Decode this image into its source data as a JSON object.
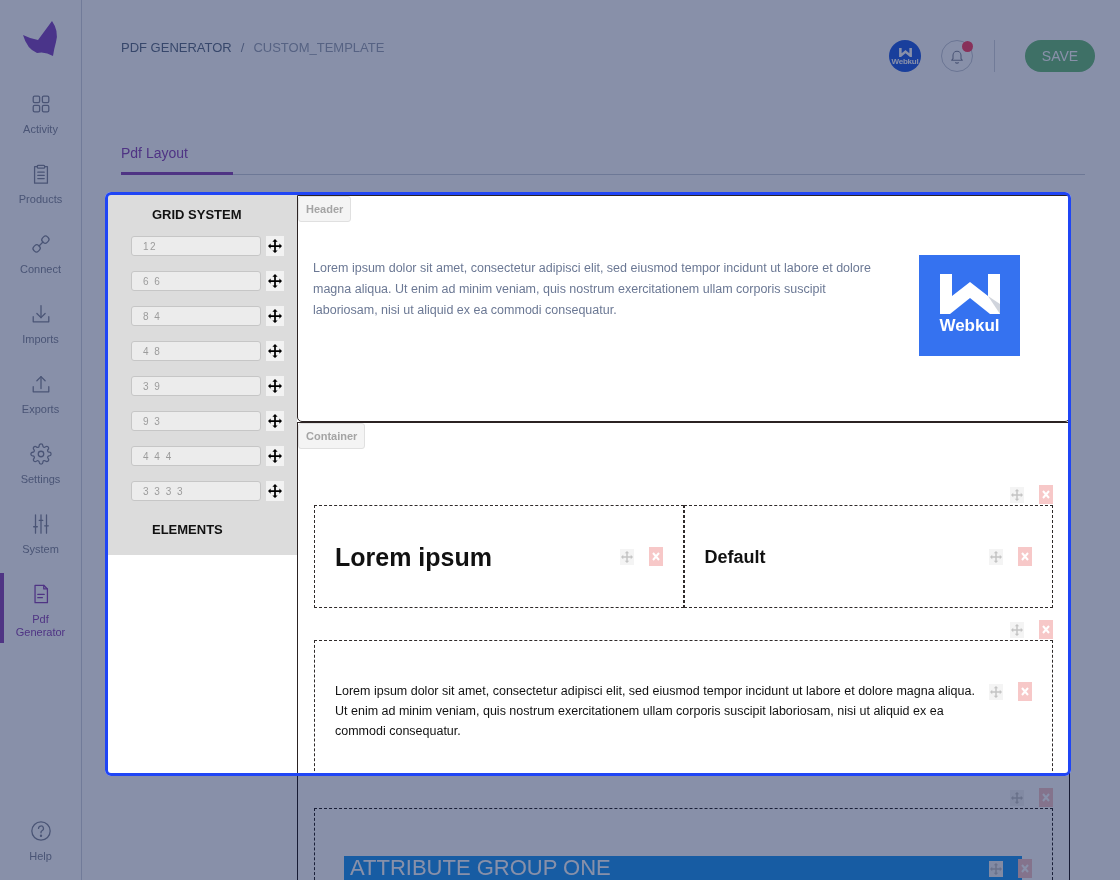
{
  "sidebar": {
    "items": [
      {
        "label": "Activity",
        "selected": false
      },
      {
        "label": "Products",
        "selected": false
      },
      {
        "label": "Connect",
        "selected": false
      },
      {
        "label": "Imports",
        "selected": false
      },
      {
        "label": "Exports",
        "selected": false
      },
      {
        "label": "Settings",
        "selected": false
      },
      {
        "label": "System",
        "selected": false
      },
      {
        "label": "Pdf Generator",
        "selected": true
      }
    ],
    "help": "Help"
  },
  "breadcrumb": {
    "items": [
      "PDF GENERATOR",
      "CUSTOM_TEMPLATE"
    ],
    "separator": "/"
  },
  "toolbar": {
    "account_logo_text": "Webkul",
    "notifications_unread": true,
    "save": "SAVE"
  },
  "tabs": [
    {
      "label": "Pdf Layout",
      "selected": true
    }
  ],
  "builder": {
    "grid_system": {
      "title": "GRID SYSTEM",
      "layouts": [
        "12",
        "6 6",
        "8 4",
        "4 8",
        "3 9",
        "9 3",
        "4 4 4",
        "3 3 3 3"
      ]
    },
    "elements": {
      "title": "ELEMENTS"
    },
    "sections": [
      {
        "kind": "header",
        "label": "Header",
        "text": "Lorem ipsum dolor sit amet, consectetur adipisci elit, sed eiusmod tempor incidunt ut labore et dolore magna aliqua. Ut enim ad minim veniam, quis nostrum exercitationem ullam corporis suscipit laboriosam, nisi ut aliquid ex ea commodi consequatur.",
        "logo_text": "Webkul"
      },
      {
        "kind": "container",
        "label": "Container",
        "rows": [
          {
            "kind": "columns",
            "cells": [
              {
                "kind": "title",
                "text": "Lorem ipsum"
              },
              {
                "kind": "subtitle",
                "text": "Default"
              }
            ]
          },
          {
            "kind": "text",
            "text": "Lorem ipsum dolor sit amet, consectetur adipisci elit, sed eiusmod tempor incidunt ut labore et dolore magna aliqua. Ut enim ad minim veniam, quis nostrum exercitationem ullam corporis suscipit laboriosam, nisi ut aliquid ex ea commodi consequatur."
          },
          {
            "kind": "attribute_group",
            "text": "ATTRIBUTE GROUP ONE"
          }
        ]
      }
    ]
  },
  "tour": {
    "active": true
  }
}
